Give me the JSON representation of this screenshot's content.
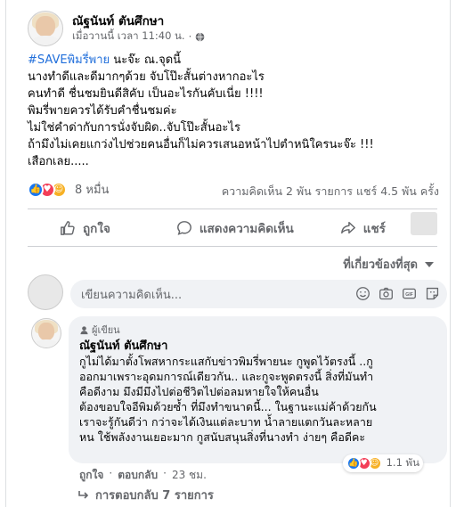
{
  "post": {
    "author": "ณัฐนันท์ ตันศึกษา",
    "time": "เมื่อวานนี้ เวลา 11:40 น.",
    "separator": "·",
    "more": "···",
    "lines": [
      {
        "hashtag": "#SAVEพิมรี่พาย",
        "text": " นะจ๊ะ ณ.จุดนี้"
      },
      {
        "text": "นางทำดีและดีมากๆด้วย จับโป๊ะสั้นต่างหากอะไร"
      },
      {
        "text": "คนทำดี ชื่นชมยินดีสิคับ เป็นอะไรกันคับเนี่ย !!!!"
      },
      {
        "text": "พิมรี่พายควรได้รับคำชื่นชมค่ะ"
      },
      {
        "text": "ไม่ใช่คำด่ากับการนั่งจับผิด..จับโป๊ะสั้นอะไร"
      },
      {
        "text": "ถ้ามึงไม่เคยแกว่งไปช่วยคนอื่นก็ไม่ควรเสนอหน้าไปตำหนิใครนะจ๊ะ !!!"
      },
      {
        "text": "เสือกเลย....."
      }
    ]
  },
  "reactions": {
    "count": "8 หมื่น",
    "stats": "ความคิดเห็น 2 พัน รายการ  แชร์ 4.5 พัน ครั้ง"
  },
  "actions": {
    "like": "ถูกใจ",
    "comment": "แสดงความคิดเห็น",
    "share": "แชร์"
  },
  "filter": {
    "label": "ที่เกี่ยวข้องที่สุด"
  },
  "composer": {
    "placeholder": "เขียนความคิดเห็น..."
  },
  "comment": {
    "badge": "ผู้เขียน",
    "author": "ณัฐนันท์ ตันศึกษา",
    "lines": [
      "กูไม่ได้มาตั้งโพสหากระแสกับข่าวพิมรี่พายนะ กูพูดไว้ตรงนี้ ..กู",
      "ออกมาเพราะอุดมการณ์เดียวกัน.. และกูจะพูดตรงนี้ สิ่งที่มันทำ",
      "คือดีงาม มึงมีมึงไปต่อชีวิตไปต่อลมหายใจให้คนอื่น",
      "ต้องขอบใจอีพิมด้วยซ้ำ ที่มึงทำขนาดนี้... ในฐานะแม่ค้าด้วยกัน",
      "เราจะรู้กันดีว่า กว่าจะได้เงินแต่ละบาท น้ำลายแตกวันละหลาย",
      "หน ใช้พลังงานเยอะมาก กูสนับสนุนสิ่งที่นางทำ ง่ายๆ คือดีคะ"
    ],
    "reaction_count": "1.1 พัน",
    "like": "ถูกใจ",
    "reply": "ตอบกลับ",
    "time": "23 ชม.",
    "view_replies": "การตอบกลับ 7 รายการ"
  }
}
